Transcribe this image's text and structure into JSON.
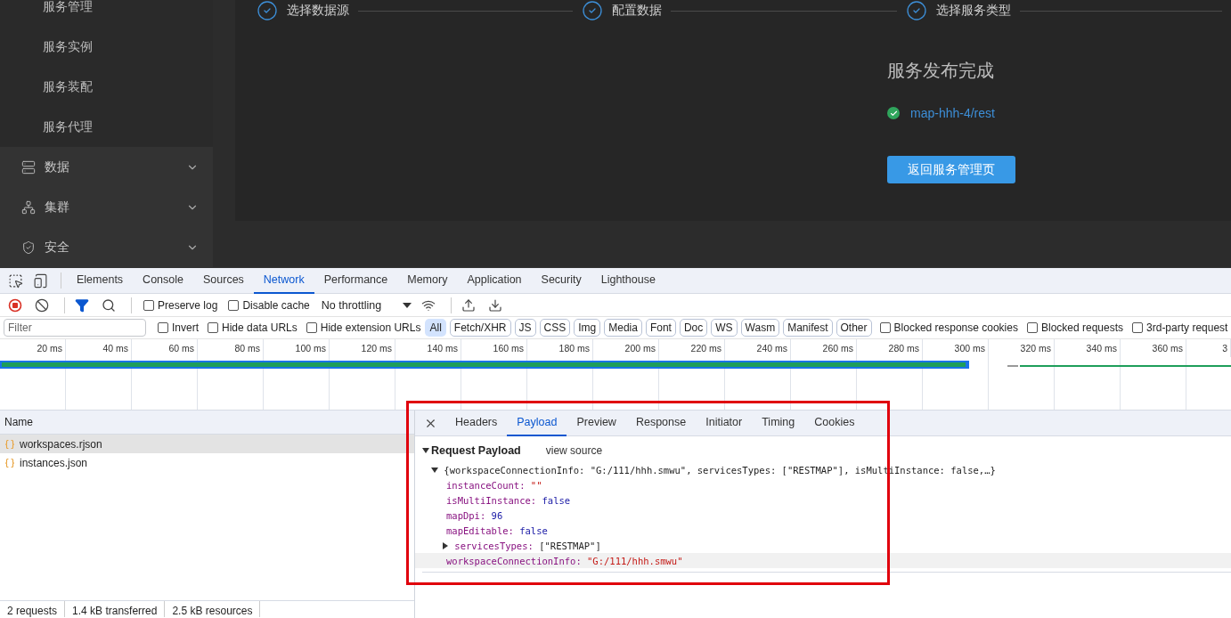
{
  "sidebar": {
    "sub_items": [
      {
        "label": "服务管理"
      },
      {
        "label": "服务实例"
      },
      {
        "label": "服务装配"
      },
      {
        "label": "服务代理"
      }
    ],
    "groups": [
      {
        "label": "数据"
      },
      {
        "label": "集群"
      },
      {
        "label": "安全"
      }
    ]
  },
  "steps": [
    {
      "label": "选择数据源",
      "done": true
    },
    {
      "label": "配置数据",
      "done": true
    },
    {
      "label": "选择服务类型",
      "done": true
    }
  ],
  "result": {
    "title": "服务发布完成",
    "services": [
      {
        "link": "map-hhh-4/rest"
      }
    ],
    "button": "返回服务管理页"
  },
  "devtools": {
    "tabs": [
      {
        "label": "Elements",
        "selected": false
      },
      {
        "label": "Console",
        "selected": false
      },
      {
        "label": "Sources",
        "selected": false
      },
      {
        "label": "Network",
        "selected": true
      },
      {
        "label": "Performance",
        "selected": false
      },
      {
        "label": "Memory",
        "selected": false
      },
      {
        "label": "Application",
        "selected": false
      },
      {
        "label": "Security",
        "selected": false
      },
      {
        "label": "Lighthouse",
        "selected": false
      }
    ],
    "toolbar_checkboxes": [
      {
        "label": "Preserve log",
        "checked": false
      },
      {
        "label": "Disable cache",
        "checked": false
      }
    ],
    "throttling": "No throttling",
    "filter": {
      "placeholder": "Filter"
    },
    "filter_checkboxes": [
      {
        "label": "Invert",
        "checked": false
      },
      {
        "label": "Hide data URLs",
        "checked": false
      },
      {
        "label": "Hide extension URLs",
        "checked": false
      }
    ],
    "type_filters": [
      {
        "label": "All",
        "selected": true
      },
      {
        "label": "Fetch/XHR",
        "selected": false
      },
      {
        "label": "JS",
        "selected": false
      },
      {
        "label": "CSS",
        "selected": false
      },
      {
        "label": "Img",
        "selected": false
      },
      {
        "label": "Media",
        "selected": false
      },
      {
        "label": "Font",
        "selected": false
      },
      {
        "label": "Doc",
        "selected": false
      },
      {
        "label": "WS",
        "selected": false
      },
      {
        "label": "Wasm",
        "selected": false
      },
      {
        "label": "Manifest",
        "selected": false
      },
      {
        "label": "Other",
        "selected": false
      }
    ],
    "extra_checkboxes": [
      {
        "label": "Blocked response cookies",
        "checked": false
      },
      {
        "label": "Blocked requests",
        "checked": false
      },
      {
        "label": "3rd-party request",
        "checked": false
      }
    ],
    "timeline_ticks": [
      "20 ms",
      "40 ms",
      "60 ms",
      "80 ms",
      "100 ms",
      "120 ms",
      "140 ms",
      "160 ms",
      "180 ms",
      "200 ms",
      "220 ms",
      "240 ms",
      "260 ms",
      "280 ms",
      "300 ms",
      "320 ms",
      "340 ms",
      "360 ms",
      "3"
    ],
    "name_header": "Name",
    "requests": [
      {
        "name": "workspaces.rjson",
        "selected": true
      },
      {
        "name": "instances.json",
        "selected": false
      }
    ],
    "status": [
      "2 requests",
      "1.4 kB transferred",
      "2.5 kB resources"
    ],
    "detail_tabs": [
      {
        "label": "Headers",
        "selected": false
      },
      {
        "label": "Payload",
        "selected": true
      },
      {
        "label": "Preview",
        "selected": false
      },
      {
        "label": "Response",
        "selected": false
      },
      {
        "label": "Initiator",
        "selected": false
      },
      {
        "label": "Timing",
        "selected": false
      },
      {
        "label": "Cookies",
        "selected": false
      }
    ],
    "payload": {
      "title": "Request Payload",
      "view_source": "view source",
      "summary": "{workspaceConnectionInfo: \"G:/111/hhh.smwu\", servicesTypes: [\"RESTMAP\"], isMultiInstance: false,…}",
      "props": [
        {
          "key": "instanceCount:",
          "value": "\"\"",
          "kind": "string",
          "selected": false
        },
        {
          "key": "isMultiInstance:",
          "value": "false",
          "kind": "literal",
          "selected": false
        },
        {
          "key": "mapDpi:",
          "value": "96",
          "kind": "literal",
          "selected": false
        },
        {
          "key": "mapEditable:",
          "value": "false",
          "kind": "literal",
          "selected": false
        },
        {
          "key": "servicesTypes:",
          "value": "[\"RESTMAP\"]",
          "kind": "array",
          "selected": false
        },
        {
          "key": "workspaceConnectionInfo:",
          "value": "\"G:/111/hhh.smwu\"",
          "kind": "string",
          "selected": true
        }
      ]
    }
  }
}
